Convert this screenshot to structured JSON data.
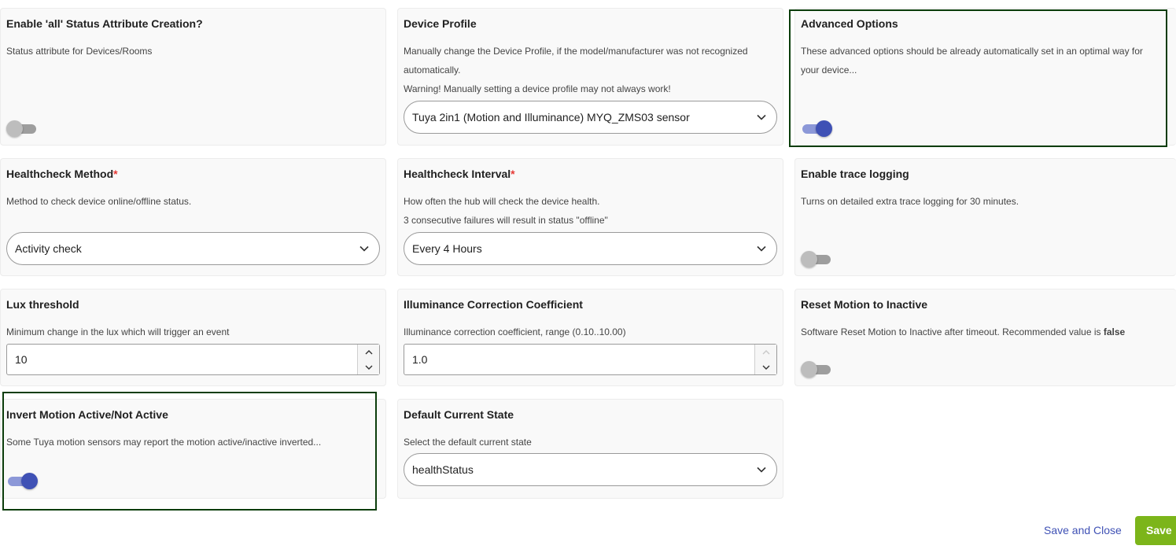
{
  "cards": {
    "status_attr": {
      "title": "Enable 'all' Status Attribute Creation?",
      "desc": "Status attribute for Devices/Rooms",
      "enabled": false
    },
    "device_profile": {
      "title": "Device Profile",
      "desc1": "Manually change the Device Profile, if the model/manufacturer was not recognized automatically.",
      "desc2": "Warning! Manually setting a device profile may not always work!",
      "value": "Tuya 2in1 (Motion and Illuminance) MYQ_ZMS03 sensor"
    },
    "advanced": {
      "title": "Advanced Options",
      "desc": "These advanced options should be already automatically set in an optimal way for your device...",
      "enabled": true
    },
    "hc_method": {
      "title": "Healthcheck Method",
      "required": "*",
      "desc": "Method to check device online/offline status.",
      "value": "Activity check"
    },
    "hc_interval": {
      "title": "Healthcheck Interval",
      "required": "*",
      "desc1": "How often the hub will check the device health.",
      "desc2": "3 consecutive failures will result in status \"offline\"",
      "value": "Every 4 Hours"
    },
    "trace": {
      "title": "Enable trace logging",
      "desc": "Turns on detailed extra trace logging for 30 minutes.",
      "enabled": false
    },
    "lux": {
      "title": "Lux threshold",
      "desc": "Minimum change in the lux which will trigger an event",
      "value": "10"
    },
    "illum": {
      "title": "Illuminance Correction Coefficient",
      "desc": "Illuminance correction coefficient, range (0.10..10.00)",
      "value": "1.0"
    },
    "reset_motion": {
      "title": "Reset Motion to Inactive",
      "desc": "Software Reset Motion to Inactive after timeout. Recommended value is ",
      "desc_bold": "false",
      "enabled": false
    },
    "invert": {
      "title": "Invert Motion Active/Not Active",
      "desc": "Some Tuya motion sensors may report the motion active/inactive inverted...",
      "enabled": true
    },
    "default_state": {
      "title": "Default Current State",
      "desc": "Select the default current state",
      "value": "healthStatus"
    }
  },
  "actions": {
    "save_close": "Save and Close",
    "save": "Save"
  },
  "colors": {
    "accent": "#3f51b5",
    "save_green": "#7cb51a",
    "highlight": "#0b3d0b",
    "required": "#e53935"
  },
  "icons": {
    "select": "chevron-down-icon",
    "stepper_up": "chevron-up-icon",
    "stepper_down": "chevron-down-icon"
  }
}
